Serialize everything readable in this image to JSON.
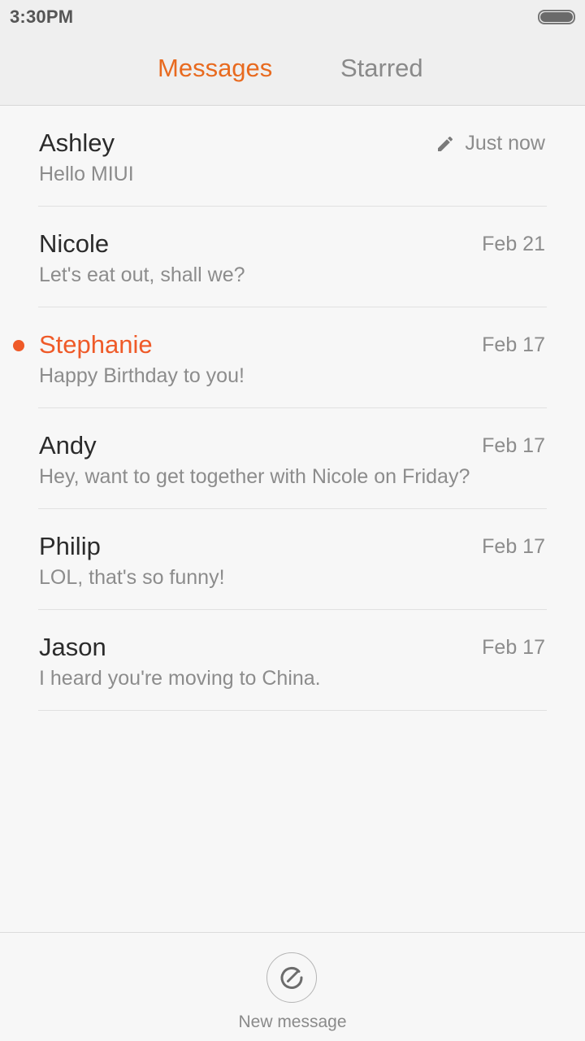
{
  "status_bar": {
    "time": "3:30PM"
  },
  "tabs": [
    {
      "label": "Messages",
      "active": true
    },
    {
      "label": "Starred",
      "active": false
    }
  ],
  "colors": {
    "accent": "#e86a1f",
    "unread": "#ef5a28",
    "text_primary": "#2b2b2b",
    "text_secondary": "#8c8c8c"
  },
  "conversations": [
    {
      "name": "Ashley",
      "preview": "Hello MIUI",
      "date": "Just now",
      "draft": true,
      "unread": false
    },
    {
      "name": "Nicole",
      "preview": "Let's eat out, shall we?",
      "date": "Feb 21",
      "draft": false,
      "unread": false
    },
    {
      "name": "Stephanie",
      "preview": "Happy Birthday to you!",
      "date": "Feb 17",
      "draft": false,
      "unread": true
    },
    {
      "name": "Andy",
      "preview": "Hey, want to get together with Nicole on Friday?",
      "date": "Feb 17",
      "draft": false,
      "unread": false
    },
    {
      "name": "Philip",
      "preview": "LOL, that's so funny!",
      "date": "Feb 17",
      "draft": false,
      "unread": false
    },
    {
      "name": "Jason",
      "preview": "I heard you're moving to China.",
      "date": "Feb 17",
      "draft": false,
      "unread": false
    }
  ],
  "bottom_bar": {
    "new_message_label": "New message",
    "icon": "compose-icon"
  }
}
